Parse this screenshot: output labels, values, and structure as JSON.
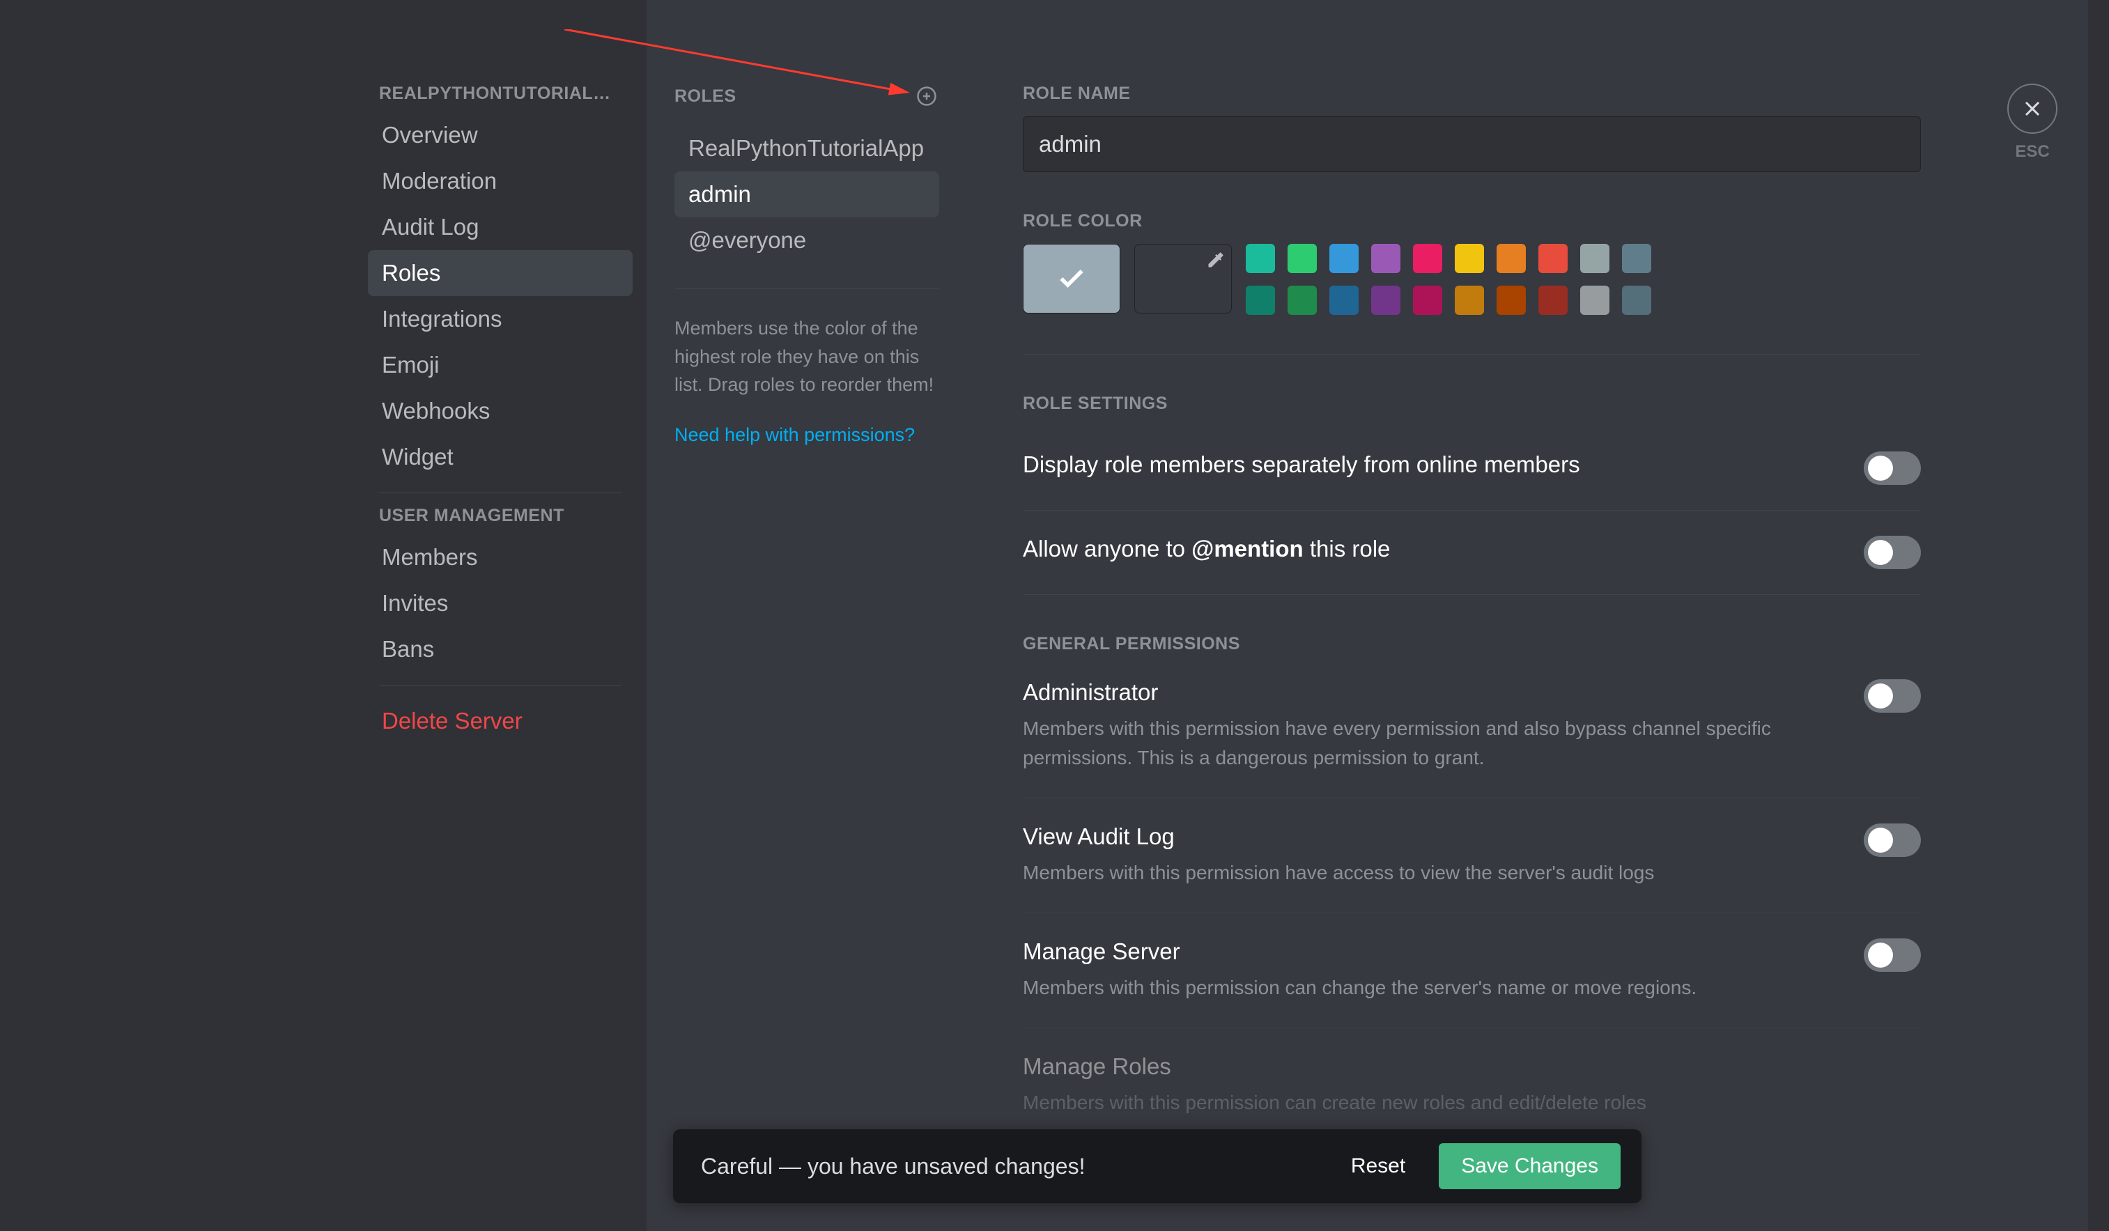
{
  "sidebar": {
    "server_heading": "RealPythonTutorialServ…",
    "items": [
      {
        "label": "Overview"
      },
      {
        "label": "Moderation"
      },
      {
        "label": "Audit Log"
      },
      {
        "label": "Roles"
      },
      {
        "label": "Integrations"
      },
      {
        "label": "Emoji"
      },
      {
        "label": "Webhooks"
      },
      {
        "label": "Widget"
      }
    ],
    "user_mgmt_heading": "User Management",
    "user_mgmt_items": [
      {
        "label": "Members"
      },
      {
        "label": "Invites"
      },
      {
        "label": "Bans"
      }
    ],
    "delete_label": "Delete Server"
  },
  "roles_col": {
    "heading": "Roles",
    "items": [
      {
        "label": "RealPythonTutorialApp"
      },
      {
        "label": "admin"
      },
      {
        "label": "@everyone"
      }
    ],
    "hint": "Members use the color of the highest role they have on this list. Drag roles to reorder them!",
    "help": "Need help with permissions?"
  },
  "main": {
    "role_name_label": "Role Name",
    "role_name_value": "admin",
    "role_color_label": "Role Color",
    "colors_row1": [
      "#1abc9c",
      "#2ecc71",
      "#3498db",
      "#9b59b6",
      "#e91e63",
      "#f1c40f",
      "#e67e22",
      "#e74c3c",
      "#95a5a6",
      "#607d8b"
    ],
    "colors_row2": [
      "#11806a",
      "#1f8b4c",
      "#206694",
      "#71368a",
      "#ad1457",
      "#c27c0e",
      "#a84300",
      "#992d22",
      "#979c9f",
      "#546e7a"
    ],
    "role_settings_label": "Role Settings",
    "setting_display": "Display role members separately from online members",
    "setting_mention_prefix": "Allow anyone to ",
    "setting_mention_bold": "@mention",
    "setting_mention_suffix": " this role",
    "general_perms_label": "General Permissions",
    "perms": [
      {
        "title": "Administrator",
        "desc": "Members with this permission have every permission and also bypass channel specific permissions. This is a dangerous permission to grant."
      },
      {
        "title": "View Audit Log",
        "desc": "Members with this permission have access to view the server's audit logs"
      },
      {
        "title": "Manage Server",
        "desc": "Members with this permission can change the server's name or move regions."
      },
      {
        "title": "Manage Roles",
        "desc": "Members with this permission can create new roles and edit/delete roles"
      }
    ]
  },
  "close": {
    "esc": "ESC"
  },
  "unsaved": {
    "text": "Careful — you have unsaved changes!",
    "reset": "Reset",
    "save": "Save Changes"
  }
}
